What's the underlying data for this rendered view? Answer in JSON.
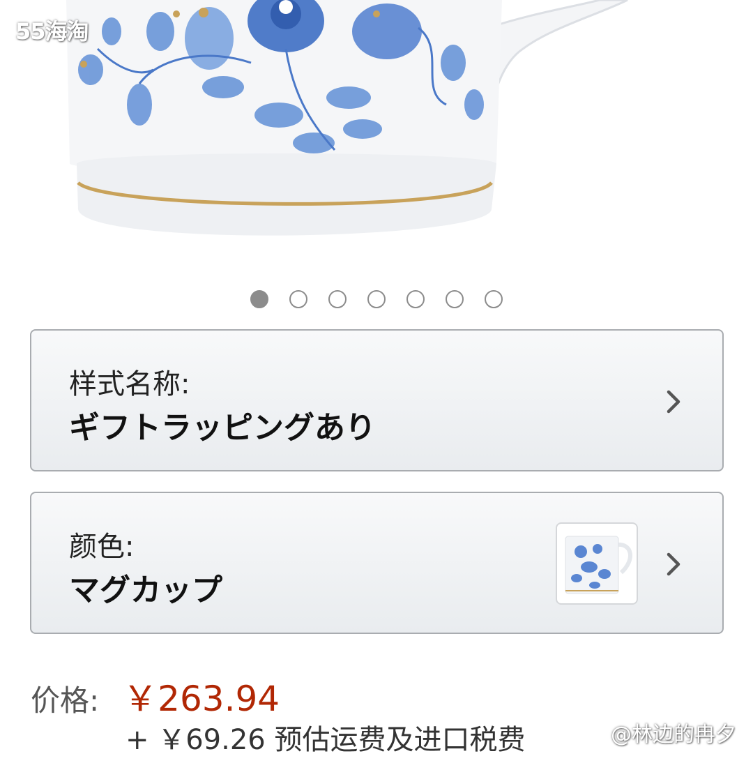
{
  "watermarks": {
    "top_left": "55海淘",
    "bottom_right": "@林边的冉夕"
  },
  "carousel": {
    "total_images": 7,
    "active_index": 0,
    "image_subject": "blue floral porcelain mug with gold rim"
  },
  "style_selector": {
    "label": "样式名称:",
    "value": "ギフトラッピングあり",
    "icon": "chevron-right-icon"
  },
  "color_selector": {
    "label": "颜色:",
    "value": "マグカップ",
    "icon": "chevron-right-icon"
  },
  "price": {
    "label": "价格:",
    "value": "￥263.94",
    "shipping": "+ ￥69.26 预估运费及进口税费"
  },
  "colors": {
    "price_red": "#b12704",
    "porcelain_blue": "#4a78c8",
    "gold_rim": "#c8a25a"
  }
}
